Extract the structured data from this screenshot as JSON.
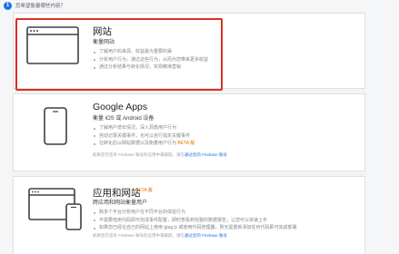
{
  "question": {
    "number": "1",
    "text": "您希望衡量哪些内容？"
  },
  "options": [
    {
      "title": "网站",
      "subtitle": "衡量网站",
      "bullets": [
        "了解用户的来源、收益最为重要的渠",
        "分析用户行为，通过这些行为，从而为您带来更多收益",
        "通过分析结果与转化情况，实现精准营销"
      ]
    },
    {
      "title": "Google Apps",
      "subtitle": "衡量 iOS 或 Android 设备",
      "bullets": [
        "了解用户增长情况，深入洞悉用户行为",
        "自动记录关键事件，也可以自行指定关键事件",
        "在转化后以网站数据以及衡量用户行为",
        "BETA 版"
      ],
      "note_text": "如果您在您有 Firebase 账号的应用中来跟踪，请在",
      "note_link": "通过您的 Firebase 账号"
    },
    {
      "title": "应用和网站",
      "badge": "BETA 版",
      "subtitle": "跨应用和网站衡量用户",
      "bullets": [
        "跨多个平台分析用户在不同平台的体验行为",
        "不需要借用代码即可完成事件配置，即时查看到完整的数据报告，让您可以快速上手",
        "如果您已经在自己的网站上使用 gtag.js 或使用代码管理器，则无需重新添加任何代码即可完成部署",
        ""
      ],
      "note_text": "如果您在您有 Firebase 账号的应用中来跟踪，请在",
      "note_link": "通过您的 Firebase 账号"
    }
  ]
}
